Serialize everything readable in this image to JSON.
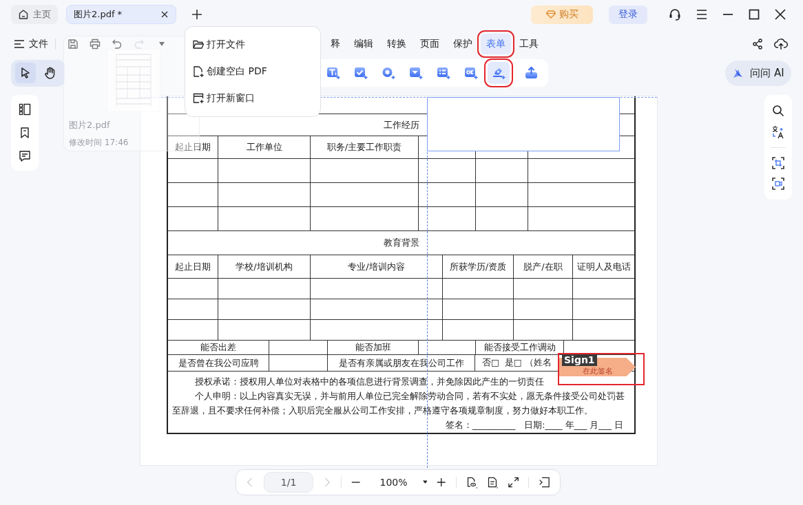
{
  "tabs": [
    {
      "kind": "home",
      "label": "主页",
      "selected": false
    },
    {
      "kind": "document",
      "label": "图片2.pdf *",
      "selected": true
    }
  ],
  "header_buttons": {
    "buy": "购买",
    "login": "登录"
  },
  "file_menu": "文件",
  "menu_tabs": [
    {
      "label": "释",
      "selected": false,
      "highlighted": false
    },
    {
      "label": "编辑",
      "selected": false,
      "highlighted": false
    },
    {
      "label": "转换",
      "selected": false,
      "highlighted": false
    },
    {
      "label": "页面",
      "selected": false,
      "highlighted": false
    },
    {
      "label": "保护",
      "selected": false,
      "highlighted": false
    },
    {
      "label": "表单",
      "selected": true,
      "highlighted": true
    },
    {
      "label": "工具",
      "selected": false,
      "highlighted": false
    }
  ],
  "nav_tools": [
    {
      "kind": "select",
      "selected": true
    },
    {
      "kind": "hand",
      "selected": false
    }
  ],
  "form_tools": [
    {
      "kind": "text",
      "selected": false,
      "highlighted": false
    },
    {
      "kind": "checkbox",
      "selected": false,
      "highlighted": false
    },
    {
      "kind": "radio",
      "selected": false,
      "highlighted": false
    },
    {
      "kind": "dropdown",
      "selected": false,
      "highlighted": false
    },
    {
      "kind": "list",
      "selected": false,
      "highlighted": false
    },
    {
      "kind": "button",
      "selected": false,
      "highlighted": false
    },
    {
      "kind": "signature",
      "selected": true,
      "highlighted": true
    },
    {
      "kind": "export",
      "selected": false,
      "highlighted": false
    }
  ],
  "ask_ai": "问问 AI",
  "dropdown": [
    {
      "kind": "open",
      "label": "打开文件"
    },
    {
      "kind": "new",
      "label": "创建空白 PDF"
    },
    {
      "kind": "window",
      "label": "打开新窗口"
    }
  ],
  "thumbnail_popup": {
    "filename": "图片2.pdf",
    "modified": "修改时间 17:46"
  },
  "document": {
    "work_history": {
      "title": "工作经历",
      "headers": [
        "起止日期",
        "工作单位",
        "职务/主要工作职责"
      ],
      "rows": [
        {
          "kind": "blank"
        },
        {
          "kind": "blank"
        },
        {
          "kind": "blank"
        }
      ]
    },
    "education": {
      "title": "教育背景",
      "headers": [
        "起止日期",
        "学校/培训机构",
        "专业/培训内容",
        "所获学历/资质",
        "脱产/在职",
        "证明人及电话"
      ],
      "rows": [
        {
          "kind": "blank"
        },
        {
          "kind": "blank"
        },
        {
          "kind": "blank"
        }
      ]
    },
    "question_rows": [
      [
        "能否出差",
        "能否加班",
        "能否接受工作调动"
      ],
      [
        "是否曾在我公司应聘",
        "是否有亲属或朋友在我公司工作"
      ]
    ],
    "relative_answer": "否□  是□ （姓名",
    "declaration": [
      "授权承诺：授权用人单位对表格中的各项信息进行背景调查，并免除因此产生的一切责任",
      "个人申明：以上内容真实无误，并与前用人单位已完全解除劳动合同，若有不实处，愿无条件接受公司处罚甚至辞退，且不要求任何补偿；入职后完全服从公司工作安排，严格遵守各项规章制度，努力做好本职工作。"
    ],
    "signature_line": "签名：__________　日期:____ 年___ 月___ 日"
  },
  "signature_field": {
    "name": "Sign1",
    "placeholder": "在此签名",
    "highlighted": true
  },
  "pager": {
    "page": "1/1",
    "zoom": "100%",
    "previous_disabled": true,
    "next_disabled": true
  }
}
